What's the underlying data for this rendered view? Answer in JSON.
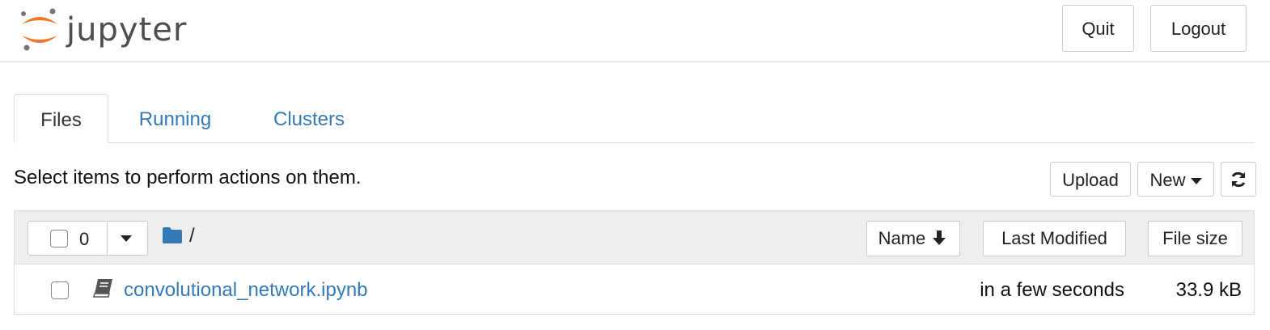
{
  "header": {
    "logo_text": "jupyter",
    "quit_label": "Quit",
    "logout_label": "Logout"
  },
  "tabs": [
    {
      "label": "Files",
      "active": true
    },
    {
      "label": "Running",
      "active": false
    },
    {
      "label": "Clusters",
      "active": false
    }
  ],
  "toolbar": {
    "instruction": "Select items to perform actions on them.",
    "upload_label": "Upload",
    "new_label": "New",
    "refresh_icon": "refresh-icon"
  },
  "list_header": {
    "selected_count": "0",
    "path": "/",
    "folder_icon": "folder-icon",
    "columns": {
      "name": "Name",
      "last_modified": "Last Modified",
      "file_size": "File size"
    },
    "sort_icon": "arrow-down-icon"
  },
  "files": [
    {
      "icon": "notebook-icon",
      "name": "convolutional_network.ipynb",
      "modified": "in a few seconds",
      "size": "33.9 kB"
    }
  ],
  "colors": {
    "link": "#337ab7",
    "logo_orange": "#f37726",
    "header_gray": "#eeeeee"
  }
}
